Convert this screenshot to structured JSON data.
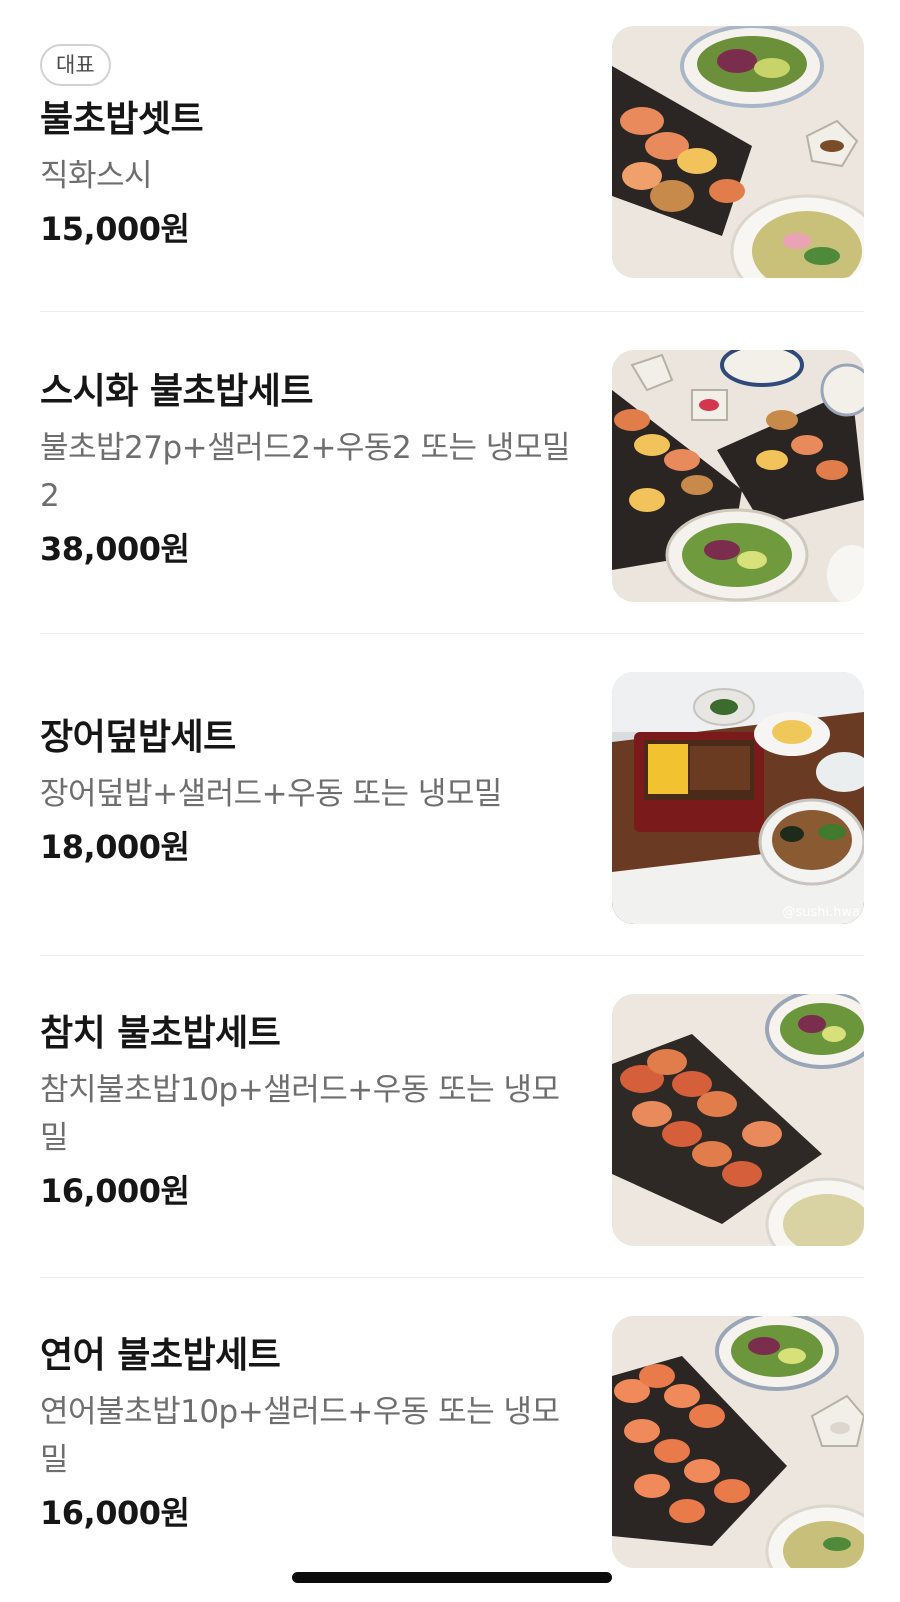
{
  "menu": {
    "items": [
      {
        "badge": "대표",
        "name": "불초밥셋트",
        "description": "직화스시",
        "price": "15,000원",
        "image_icon": "food-photo-icon"
      },
      {
        "name": "스시화 불초밥세트",
        "description": "불초밥27p+샐러드2+우동2 또는 냉모밀2",
        "price": "38,000원",
        "image_icon": "food-photo-icon"
      },
      {
        "name": "장어덮밥세트",
        "description": "장어덮밥+샐러드+우동 또는 냉모밀",
        "price": "18,000원",
        "image_icon": "food-photo-icon",
        "image_watermark": "@sushi.hwa"
      },
      {
        "name": "참치 불초밥세트",
        "description": "참치불초밥10p+샐러드+우동 또는 냉모밀",
        "price": "16,000원",
        "image_icon": "food-photo-icon"
      },
      {
        "name": "연어 불초밥세트",
        "description": "연어불초밥10p+샐러드+우동 또는 냉모밀",
        "price": "16,000원",
        "image_icon": "food-photo-icon"
      }
    ]
  },
  "colors": {
    "background": "#ffffff",
    "text_primary": "#161616",
    "text_secondary": "#6e6e6e",
    "divider": "#ececec",
    "badge_border": "#d2d2d2"
  }
}
